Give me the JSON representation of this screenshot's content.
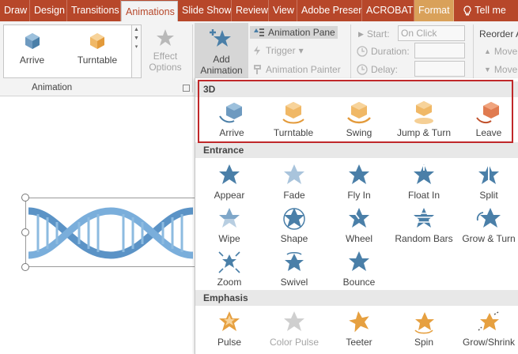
{
  "tabs": [
    "Draw",
    "Design",
    "Transitions",
    "Animations",
    "Slide Show",
    "Review",
    "View",
    "Adobe Presen",
    "ACROBAT",
    "Format",
    "Tell me"
  ],
  "ribbon": {
    "gallery": [
      "Arrive",
      "Turntable"
    ],
    "effect_options": [
      "Effect",
      "Options"
    ],
    "animation_group_label": "Animation",
    "add_animation": [
      "Add",
      "Animation"
    ],
    "animation_pane": "Animation Pane",
    "trigger": "Trigger",
    "animation_painter": "Animation Painter",
    "start_label": "Start:",
    "start_value": "On Click",
    "duration_label": "Duration:",
    "delay_label": "Delay:",
    "reorder": "Reorder A",
    "move1": "Move",
    "move2": "Move"
  },
  "panel": {
    "sections": [
      {
        "title": "3D",
        "items": [
          "Arrive",
          "Turntable",
          "Swing",
          "Jump & Turn",
          "Leave"
        ]
      },
      {
        "title": "Entrance",
        "items": [
          "Appear",
          "Fade",
          "Fly In",
          "Float In",
          "Split",
          "Wipe",
          "Shape",
          "Wheel",
          "Random Bars",
          "Grow & Turn",
          "Zoom",
          "Swivel",
          "Bounce"
        ]
      },
      {
        "title": "Emphasis",
        "items": [
          "Pulse",
          "Color Pulse",
          "Teeter",
          "Spin",
          "Grow/Shrink"
        ]
      }
    ]
  },
  "colors": {
    "accent": "#b7472a",
    "format_tab": "#d9a15a",
    "highlight": "#c0282a",
    "entrance_star": "#4a7fa8",
    "emphasis_star": "#e6a040"
  }
}
